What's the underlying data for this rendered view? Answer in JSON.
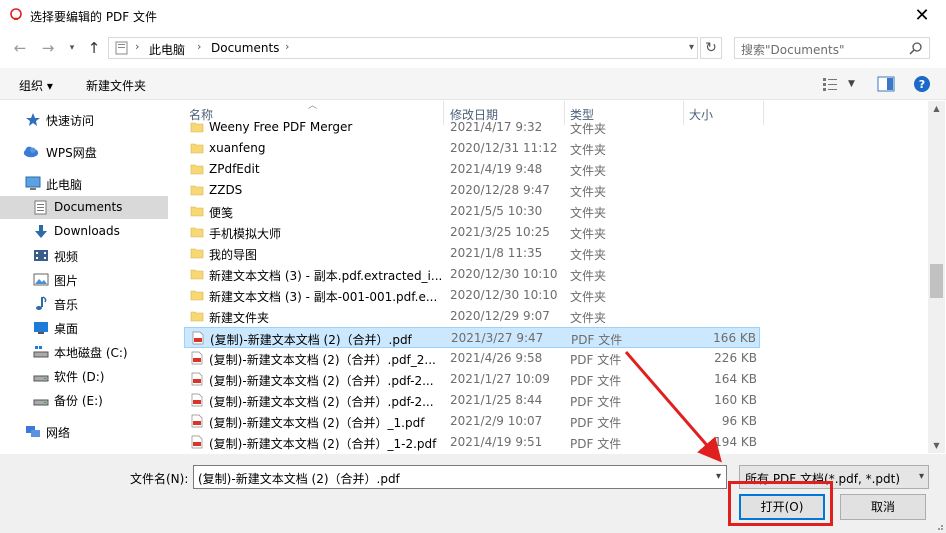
{
  "window": {
    "title": "选择要编辑的 PDF 文件",
    "close_glyph": "✕"
  },
  "address": {
    "crumbs": [
      "此电脑",
      "Documents"
    ],
    "search_placeholder": "搜索\"Documents\""
  },
  "toolbar": {
    "organize_label": "组织 ▾",
    "new_folder_label": "新建文件夹"
  },
  "nav": {
    "items": [
      {
        "label": "快速访问",
        "icon": "star-icon"
      },
      {
        "label": "WPS网盘",
        "icon": "cloud-icon"
      },
      {
        "label": "此电脑",
        "icon": "computer-icon"
      },
      {
        "label": "Documents",
        "icon": "documents-icon"
      },
      {
        "label": "Downloads",
        "icon": "download-icon"
      },
      {
        "label": "视频",
        "icon": "video-icon"
      },
      {
        "label": "图片",
        "icon": "picture-icon"
      },
      {
        "label": "音乐",
        "icon": "music-icon"
      },
      {
        "label": "桌面",
        "icon": "desktop-icon"
      },
      {
        "label": "本地磁盘 (C:)",
        "icon": "drive-c-icon"
      },
      {
        "label": "软件 (D:)",
        "icon": "drive-icon"
      },
      {
        "label": "备份 (E:)",
        "icon": "drive-icon"
      },
      {
        "label": "网络",
        "icon": "network-icon"
      }
    ]
  },
  "columns": {
    "name": "名称",
    "date": "修改日期",
    "type": "类型",
    "size": "大小"
  },
  "files": [
    {
      "name": "Weeny Free PDF Merger",
      "date": "2021/4/17 9:32",
      "type": "文件夹",
      "size": "",
      "kind": "folder"
    },
    {
      "name": "xuanfeng",
      "date": "2020/12/31 11:12",
      "type": "文件夹",
      "size": "",
      "kind": "folder"
    },
    {
      "name": "ZPdfEdit",
      "date": "2021/4/19 9:48",
      "type": "文件夹",
      "size": "",
      "kind": "folder"
    },
    {
      "name": "ZZDS",
      "date": "2020/12/28 9:47",
      "type": "文件夹",
      "size": "",
      "kind": "folder"
    },
    {
      "name": "便笺",
      "date": "2021/5/5 10:30",
      "type": "文件夹",
      "size": "",
      "kind": "folder"
    },
    {
      "name": "手机模拟大师",
      "date": "2021/3/25 10:25",
      "type": "文件夹",
      "size": "",
      "kind": "folder"
    },
    {
      "name": "我的导图",
      "date": "2021/1/8 11:35",
      "type": "文件夹",
      "size": "",
      "kind": "folder"
    },
    {
      "name": "新建文本文档 (3) - 副本.pdf.extracted_i...",
      "date": "2020/12/30 10:10",
      "type": "文件夹",
      "size": "",
      "kind": "folder"
    },
    {
      "name": "新建文本文档 (3) - 副本-001-001.pdf.e...",
      "date": "2020/12/30 10:10",
      "type": "文件夹",
      "size": "",
      "kind": "folder"
    },
    {
      "name": "新建文件夹",
      "date": "2020/12/29 9:07",
      "type": "文件夹",
      "size": "",
      "kind": "folder"
    },
    {
      "name": "(复制)-新建文本文档 (2)（合并）.pdf",
      "date": "2021/3/27 9:47",
      "type": "PDF 文件",
      "size": "166 KB",
      "kind": "pdf",
      "selected": true
    },
    {
      "name": "(复制)-新建文本文档 (2)（合并）.pdf_2...",
      "date": "2021/4/26 9:58",
      "type": "PDF 文件",
      "size": "226 KB",
      "kind": "pdf"
    },
    {
      "name": "(复制)-新建文本文档 (2)（合并）.pdf-2...",
      "date": "2021/1/27 10:09",
      "type": "PDF 文件",
      "size": "164 KB",
      "kind": "pdf"
    },
    {
      "name": "(复制)-新建文本文档 (2)（合并）.pdf-2...",
      "date": "2021/1/25 8:44",
      "type": "PDF 文件",
      "size": "160 KB",
      "kind": "pdf"
    },
    {
      "name": "(复制)-新建文本文档 (2)（合并）_1.pdf",
      "date": "2021/2/9 10:07",
      "type": "PDF 文件",
      "size": "96 KB",
      "kind": "pdf"
    },
    {
      "name": "(复制)-新建文本文档 (2)（合并）_1-2.pdf",
      "date": "2021/4/19 9:51",
      "type": "PDF 文件",
      "size": "194 KB",
      "kind": "pdf"
    }
  ],
  "bottom": {
    "filename_label": "文件名(N):",
    "filename_value": "(复制)-新建文本文档 (2)（合并）.pdf",
    "filter_value": "所有 PDF 文档(*.pdf, *.pdt)",
    "open_label": "打开(O)",
    "cancel_label": "取消"
  },
  "annotation_color": "#e0201f"
}
